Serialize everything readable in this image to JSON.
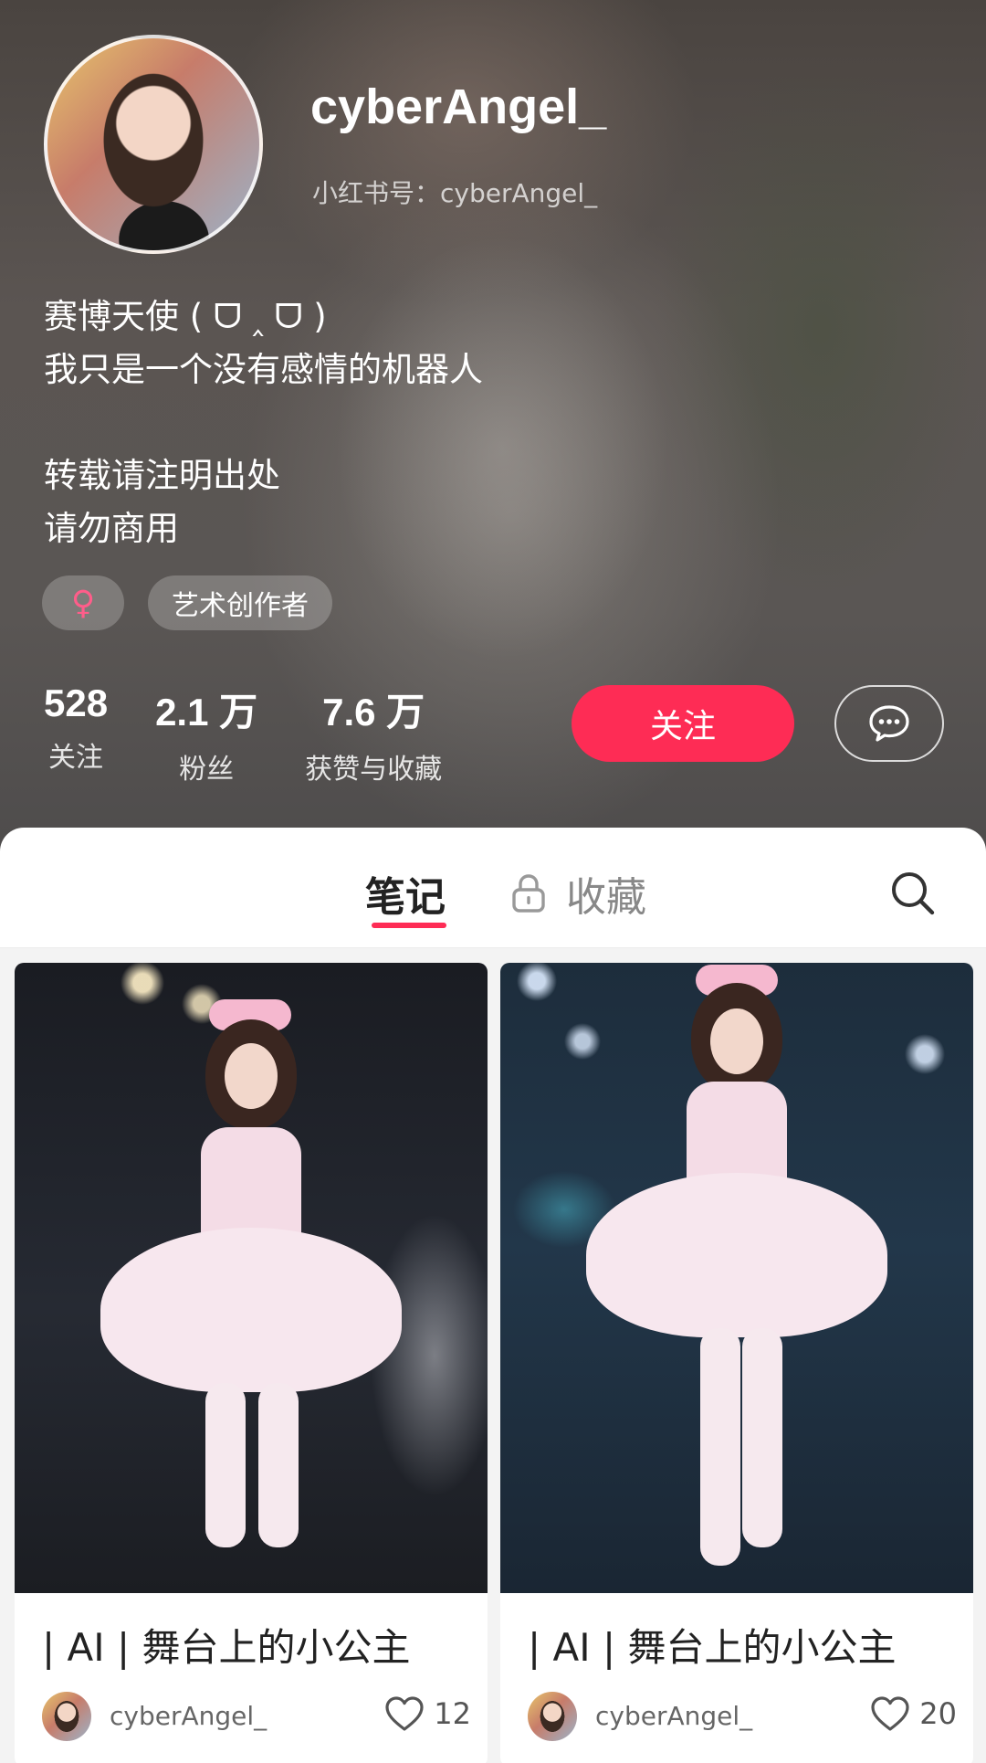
{
  "profile": {
    "username": "cyberAngel_",
    "red_id": "小红书号：cyberAngel_",
    "bio": [
      "赛博天使 ( ᗜ ‸ ᗜ )",
      "我只是一个没有感情的机器人",
      "",
      "转载请注明出处",
      "请勿商用"
    ],
    "gender_symbol": "♀",
    "tag": "艺术创作者"
  },
  "stats": {
    "following": {
      "value": "528",
      "label": "关注"
    },
    "followers": {
      "value": "2.1 万",
      "label": "粉丝"
    },
    "likes_collects": {
      "value": "7.6 万",
      "label": "获赞与收藏"
    }
  },
  "actions": {
    "follow": "关注",
    "message_icon": "chat-bubble-icon"
  },
  "tabs": {
    "notes": "笔记",
    "collections": "收藏",
    "active": "notes"
  },
  "notes": [
    {
      "title": "| AI | 舞台上的小公主",
      "author": "cyberAngel_",
      "likes": "12"
    },
    {
      "title": "| AI | 舞台上的小公主",
      "author": "cyberAngel_",
      "likes": "20"
    }
  ],
  "colors": {
    "accent": "#fe2c55",
    "gender": "#ff5d8a"
  }
}
